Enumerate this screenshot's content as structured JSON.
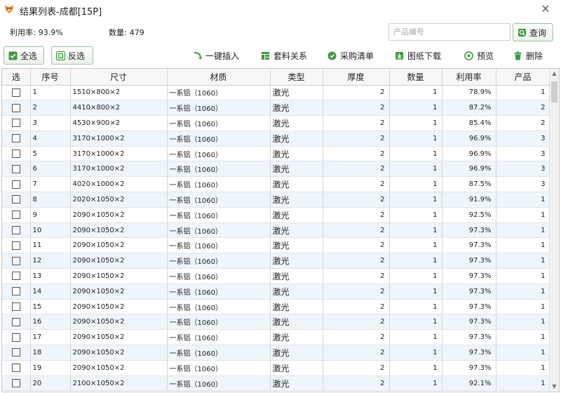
{
  "window": {
    "title": "结果列表-成都[15P]",
    "accent": "#f5a623"
  },
  "info": {
    "utilization_label": "利用率:",
    "utilization_value": "93.9%",
    "count_label": "数量:",
    "count_value": "479"
  },
  "search": {
    "placeholder": "产品编号",
    "value": "",
    "button_label": "查询"
  },
  "buttons": {
    "select_all": "全选",
    "invert": "反选"
  },
  "toolbar": [
    {
      "label": "一键插入",
      "icon": "insert-icon"
    },
    {
      "label": "套料关系",
      "icon": "nesting-icon"
    },
    {
      "label": "采购清单",
      "icon": "purchase-icon"
    },
    {
      "label": "图纸下载",
      "icon": "download-icon"
    },
    {
      "label": "预览",
      "icon": "preview-icon"
    },
    {
      "label": "删除",
      "icon": "delete-icon"
    }
  ],
  "table": {
    "columns": [
      "选",
      "序号",
      "尺寸",
      "材质",
      "类型",
      "厚度",
      "数量",
      "利用率",
      "产品"
    ],
    "rows": [
      [
        "1",
        "1510×800×2",
        "一系铝（1060）",
        "激光",
        "2",
        "1",
        "78.9%",
        "1"
      ],
      [
        "2",
        "4410×800×2",
        "一系铝（1060）",
        "激光",
        "2",
        "1",
        "87.2%",
        "2"
      ],
      [
        "3",
        "4530×900×2",
        "一系铝（1060）",
        "激光",
        "2",
        "1",
        "85.4%",
        "2"
      ],
      [
        "4",
        "3170×1000×2",
        "一系铝（1060）",
        "激光",
        "2",
        "1",
        "96.9%",
        "3"
      ],
      [
        "5",
        "3170×1000×2",
        "一系铝（1060）",
        "激光",
        "2",
        "1",
        "96.9%",
        "3"
      ],
      [
        "6",
        "3170×1000×2",
        "一系铝（1060）",
        "激光",
        "2",
        "1",
        "96.9%",
        "3"
      ],
      [
        "7",
        "4020×1000×2",
        "一系铝（1060）",
        "激光",
        "2",
        "1",
        "87.5%",
        "3"
      ],
      [
        "8",
        "2020×1050×2",
        "一系铝（1060）",
        "激光",
        "2",
        "1",
        "91.9%",
        "1"
      ],
      [
        "9",
        "2090×1050×2",
        "一系铝（1060）",
        "激光",
        "2",
        "1",
        "92.5%",
        "1"
      ],
      [
        "10",
        "2090×1050×2",
        "一系铝（1060）",
        "激光",
        "2",
        "1",
        "97.3%",
        "1"
      ],
      [
        "11",
        "2090×1050×2",
        "一系铝（1060）",
        "激光",
        "2",
        "1",
        "97.3%",
        "1"
      ],
      [
        "12",
        "2090×1050×2",
        "一系铝（1060）",
        "激光",
        "2",
        "1",
        "97.3%",
        "1"
      ],
      [
        "13",
        "2090×1050×2",
        "一系铝（1060）",
        "激光",
        "2",
        "1",
        "97.3%",
        "1"
      ],
      [
        "14",
        "2090×1050×2",
        "一系铝（1060）",
        "激光",
        "2",
        "1",
        "97.3%",
        "1"
      ],
      [
        "15",
        "2090×1050×2",
        "一系铝（1060）",
        "激光",
        "2",
        "1",
        "97.3%",
        "1"
      ],
      [
        "16",
        "2090×1050×2",
        "一系铝（1060）",
        "激光",
        "2",
        "1",
        "97.3%",
        "1"
      ],
      [
        "17",
        "2090×1050×2",
        "一系铝（1060）",
        "激光",
        "2",
        "1",
        "97.3%",
        "1"
      ],
      [
        "18",
        "2090×1050×2",
        "一系铝（1060）",
        "激光",
        "2",
        "1",
        "97.3%",
        "1"
      ],
      [
        "19",
        "2090×1050×2",
        "一系铝（1060）",
        "激光",
        "2",
        "1",
        "97.3%",
        "1"
      ],
      [
        "20",
        "2100×1050×2",
        "一系铝（1060）",
        "激光",
        "2",
        "1",
        "92.1%",
        "1"
      ]
    ]
  }
}
